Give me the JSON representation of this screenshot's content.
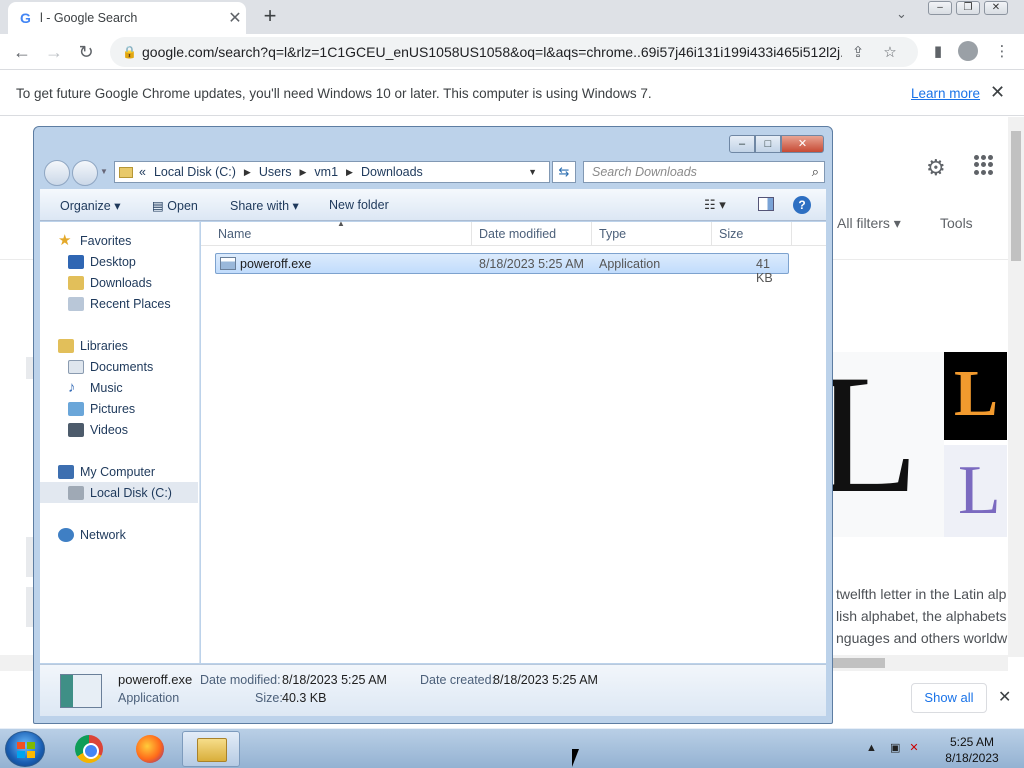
{
  "browser": {
    "tab_title": "l - Google Search",
    "tab_favicon": "G",
    "url": "google.com/search?q=l&rlz=1C1GCEU_enUS1058US1058&oq=l&aqs=chrome..69i57j46i131i199i433i465i512l2j...",
    "infobar_message": "To get future Google Chrome updates, you'll need Windows 10 or later. This computer is using Windows 7.",
    "infobar_link": "Learn more"
  },
  "google": {
    "all_filters": "All filters",
    "tools": "Tools",
    "kp_letter": "L",
    "desc_lines": [
      "twelfth letter in the Latin alp",
      "lish alphabet, the alphabets",
      "nguages and others worldwi"
    ],
    "show_all": "Show all"
  },
  "explorer": {
    "address": {
      "prefix": "«",
      "crumbs": [
        "Local Disk (C:)",
        "Users",
        "vm1",
        "Downloads"
      ]
    },
    "search_placeholder": "Search Downloads",
    "toolbar": {
      "organize": "Organize",
      "open": "Open",
      "share_with": "Share with",
      "new_folder": "New folder"
    },
    "nav": {
      "favorites": "Favorites",
      "desktop": "Desktop",
      "downloads": "Downloads",
      "recent_places": "Recent Places",
      "libraries": "Libraries",
      "documents": "Documents",
      "music": "Music",
      "pictures": "Pictures",
      "videos": "Videos",
      "my_computer": "My Computer",
      "local_disk": "Local Disk (C:)",
      "network": "Network"
    },
    "columns": {
      "name": "Name",
      "date_modified": "Date modified",
      "type": "Type",
      "size": "Size"
    },
    "files": [
      {
        "name": "poweroff.exe",
        "date_modified": "8/18/2023 5:25 AM",
        "type": "Application",
        "size": "41 KB"
      }
    ],
    "details": {
      "name": "poweroff.exe",
      "type": "Application",
      "date_modified_label": "Date modified:",
      "date_modified": "8/18/2023 5:25 AM",
      "date_created_label": "Date created:",
      "date_created": "8/18/2023 5:25 AM",
      "size_label": "Size:",
      "size": "40.3 KB"
    }
  },
  "taskbar": {
    "time": "5:25 AM",
    "date": "8/18/2023"
  }
}
